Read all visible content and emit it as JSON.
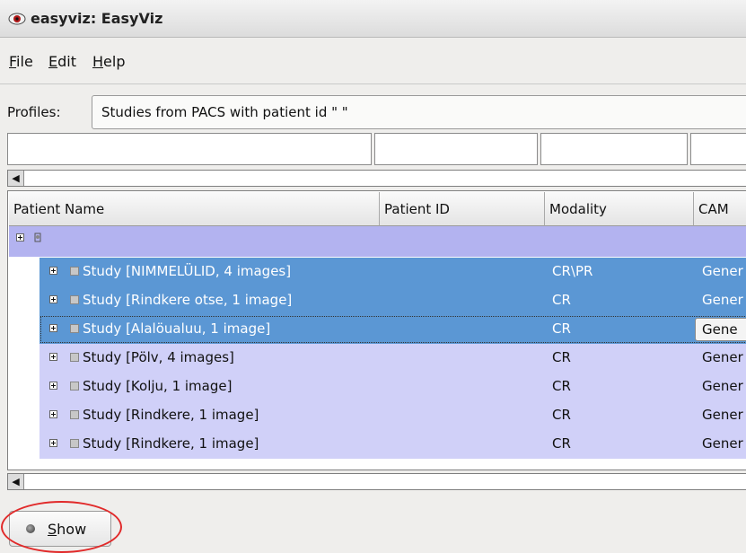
{
  "window": {
    "title": "easyviz: EasyViz"
  },
  "menu": {
    "file": {
      "mnemonic": "F",
      "rest": "ile"
    },
    "edit": {
      "mnemonic": "E",
      "rest": "dit"
    },
    "help": {
      "mnemonic": "H",
      "rest": "elp"
    }
  },
  "profiles": {
    "label": "Profiles:",
    "selected": "Studies from PACS with patient id \"                         \""
  },
  "table": {
    "columns": [
      "Patient Name",
      "Patient ID",
      "Modality",
      "CAM"
    ],
    "rows": [
      {
        "text": "Study [NIMMELÜLID, 4 images]",
        "modality": "CR\\PR",
        "cam": "Gener",
        "selected": true
      },
      {
        "text": "Study [Rindkere otse, 1 image]",
        "modality": "CR",
        "cam": "Gener",
        "selected": true
      },
      {
        "text": "Study [Alalöualuu, 1 image]",
        "modality": "CR",
        "cam": "Gene",
        "selected": true
      },
      {
        "text": "Study [Pölv, 4 images]",
        "modality": "CR",
        "cam": "Gener",
        "selected": false
      },
      {
        "text": "Study [Kolju, 1 image]",
        "modality": "CR",
        "cam": "Gener",
        "selected": false
      },
      {
        "text": "Study [Rindkere, 1 image]",
        "modality": "CR",
        "cam": "Gener",
        "selected": false
      },
      {
        "text": "Study [Rindkere, 1 image]",
        "modality": "CR",
        "cam": "Gener",
        "selected": false
      }
    ]
  },
  "scroll_arrow": "◀",
  "show_button": {
    "mnemonic": "S",
    "rest": "how"
  },
  "colors": {
    "selected_row": "#5b97d4",
    "unselected_row": "#d0d0f8",
    "root_row": "#b3b3f0",
    "annotation": "#e12a2a"
  }
}
